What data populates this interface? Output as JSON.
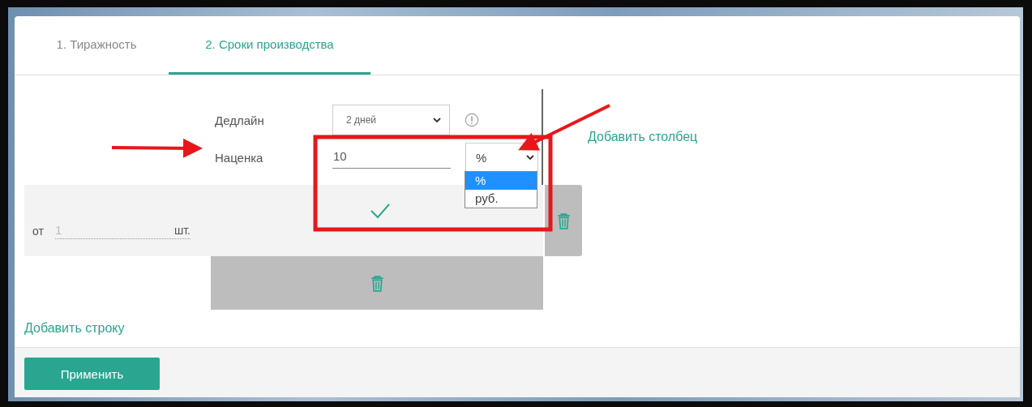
{
  "tabs": [
    {
      "label": "1. Тиражность",
      "selected": false
    },
    {
      "label": "2. Сроки производства",
      "selected": true
    }
  ],
  "popover": {
    "deadline": {
      "label": "Дедлайн",
      "value": "2 дней"
    },
    "markup": {
      "label": "Наценка",
      "value": "10",
      "unit": "%",
      "options": [
        {
          "label": "%",
          "selected": true
        },
        {
          "label": "руб.",
          "selected": false
        }
      ]
    }
  },
  "table": {
    "rows": [
      {
        "prefix": "от",
        "placeholder": "1",
        "unit": "шт."
      }
    ]
  },
  "add_column_link": "Добавить столбец",
  "add_row_link": "Добавить строку",
  "apply_button": "Применить"
}
